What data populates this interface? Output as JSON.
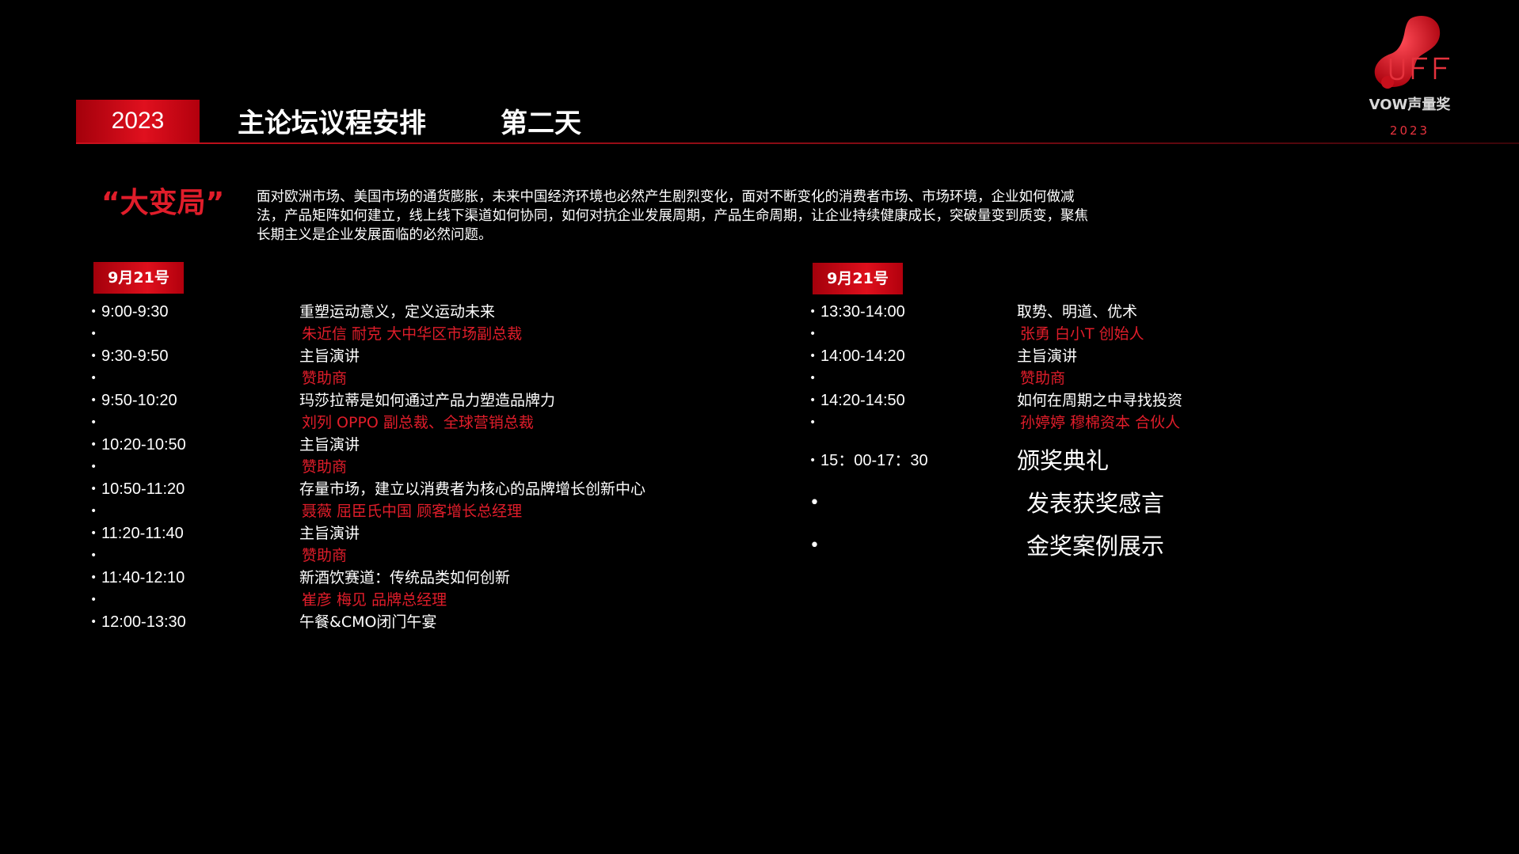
{
  "header": {
    "year_badge": "2023",
    "title": "主论坛议程安排",
    "day": "第二天"
  },
  "logo": {
    "mark": "UFF",
    "brand": "VOW声量奖",
    "year": "2023",
    "colors": {
      "primary": "#c8101c",
      "accent": "#e5323d"
    }
  },
  "intro": {
    "quote_title": "“大变局”",
    "paragraph": "面对欧洲市场、美国市场的通货膨胀，未来中国经济环境也必然产生剧烈变化，面对不断变化的消费者市场、市场环境，企业如何做减法，产品矩阵如何建立，线上线下渠道如何协同，如何对抗企业发展周期，产品生命周期，让企业持续健康成长，突破量变到质变，聚焦长期主义是企业发展面临的必然问题。"
  },
  "left_column": {
    "date": "9月21号",
    "items": [
      {
        "time": "9:00-9:30",
        "topic": "重塑运动意义，定义运动未来",
        "speaker": "朱近信 耐克 大中华区市场副总裁"
      },
      {
        "time": "9:30-9:50",
        "topic": "主旨演讲",
        "speaker": "赞助商"
      },
      {
        "time": "9:50-10:20",
        "topic": "玛莎拉蒂是如何通过产品力塑造品牌力",
        "speaker": "刘列 OPPO 副总裁、全球营销总裁"
      },
      {
        "time": "10:20-10:50",
        "topic": "主旨演讲",
        "speaker": "赞助商"
      },
      {
        "time": "10:50-11:20",
        "topic": "存量市场，建立以消费者为核心的品牌增长创新中心",
        "speaker": "聂薇 屈臣氏中国 顾客增长总经理"
      },
      {
        "time": "11:20-11:40",
        "topic": "主旨演讲",
        "speaker": "赞助商"
      },
      {
        "time": "11:40-12:10",
        "topic": "新酒饮赛道：传统品类如何创新",
        "speaker": "崔彦 梅见 品牌总经理"
      },
      {
        "time": "12:00-13:30",
        "topic": "午餐&CMO闭门午宴",
        "speaker": ""
      }
    ]
  },
  "right_column": {
    "date": "9月21号",
    "items": [
      {
        "time": "13:30-14:00",
        "topic": "取势、明道、优术",
        "speaker": "张勇 白小T 创始人"
      },
      {
        "time": "14:00-14:20",
        "topic": "主旨演讲",
        "speaker": "赞助商"
      },
      {
        "time": "14:20-14:50",
        "topic": "如何在周期之中寻找投资",
        "speaker": "孙婷婷  穆棉资本  合伙人"
      }
    ],
    "ceremony": {
      "time": "15：00-17：30",
      "title": "颁奖典礼",
      "sub_items": [
        "发表获奖感言",
        "金奖案例展示"
      ]
    }
  }
}
